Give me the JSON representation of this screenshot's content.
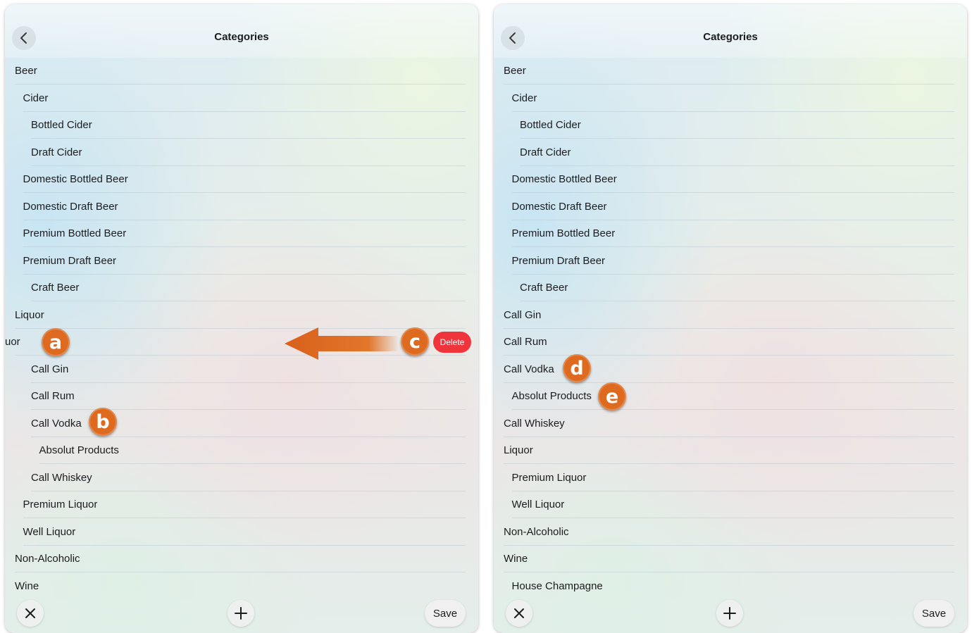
{
  "left_panel": {
    "title": "Categories",
    "rows": [
      {
        "label": "Beer",
        "indent": 0
      },
      {
        "label": "Cider",
        "indent": 1
      },
      {
        "label": "Bottled Cider",
        "indent": 2
      },
      {
        "label": "Draft Cider",
        "indent": 2
      },
      {
        "label": "Domestic Bottled Beer",
        "indent": 1
      },
      {
        "label": "Domestic Draft Beer",
        "indent": 1
      },
      {
        "label": "Premium Bottled Beer",
        "indent": 1
      },
      {
        "label": "Premium Draft Beer",
        "indent": 1
      },
      {
        "label": "Craft Beer",
        "indent": 2
      },
      {
        "label": "Liquor",
        "indent": 0
      },
      {
        "label": "uor",
        "indent": -1,
        "swiped": true
      },
      {
        "label": "Call Gin",
        "indent": 2
      },
      {
        "label": "Call Rum",
        "indent": 2
      },
      {
        "label": "Call Vodka",
        "indent": 2
      },
      {
        "label": "Absolut Products",
        "indent": 3
      },
      {
        "label": "Call Whiskey",
        "indent": 2
      },
      {
        "label": "Premium Liquor",
        "indent": 1
      },
      {
        "label": "Well Liquor",
        "indent": 1
      },
      {
        "label": "Non-Alcoholic",
        "indent": 0
      },
      {
        "label": "Wine",
        "indent": 0
      }
    ],
    "delete_label": "Delete",
    "save_label": "Save"
  },
  "right_panel": {
    "title": "Categories",
    "rows": [
      {
        "label": "Beer",
        "indent": 0
      },
      {
        "label": "Cider",
        "indent": 1
      },
      {
        "label": "Bottled Cider",
        "indent": 2
      },
      {
        "label": "Draft Cider",
        "indent": 2
      },
      {
        "label": "Domestic Bottled Beer",
        "indent": 1
      },
      {
        "label": "Domestic Draft Beer",
        "indent": 1
      },
      {
        "label": "Premium Bottled Beer",
        "indent": 1
      },
      {
        "label": "Premium Draft Beer",
        "indent": 1
      },
      {
        "label": "Craft Beer",
        "indent": 2
      },
      {
        "label": "Call Gin",
        "indent": 0
      },
      {
        "label": "Call Rum",
        "indent": 0
      },
      {
        "label": "Call Vodka",
        "indent": 0
      },
      {
        "label": "Absolut Products",
        "indent": 1
      },
      {
        "label": "Call Whiskey",
        "indent": 0
      },
      {
        "label": "Liquor",
        "indent": 0
      },
      {
        "label": "Premium Liquor",
        "indent": 1
      },
      {
        "label": "Well Liquor",
        "indent": 1
      },
      {
        "label": "Non-Alcoholic",
        "indent": 0
      },
      {
        "label": "Wine",
        "indent": 0
      },
      {
        "label": "House Champagne",
        "indent": 1
      }
    ],
    "save_label": "Save"
  },
  "callouts": {
    "a": "a",
    "b": "b",
    "c": "c",
    "d": "d",
    "e": "e"
  },
  "colors": {
    "callout": "#dd6a1e",
    "delete": "#f0343c"
  }
}
